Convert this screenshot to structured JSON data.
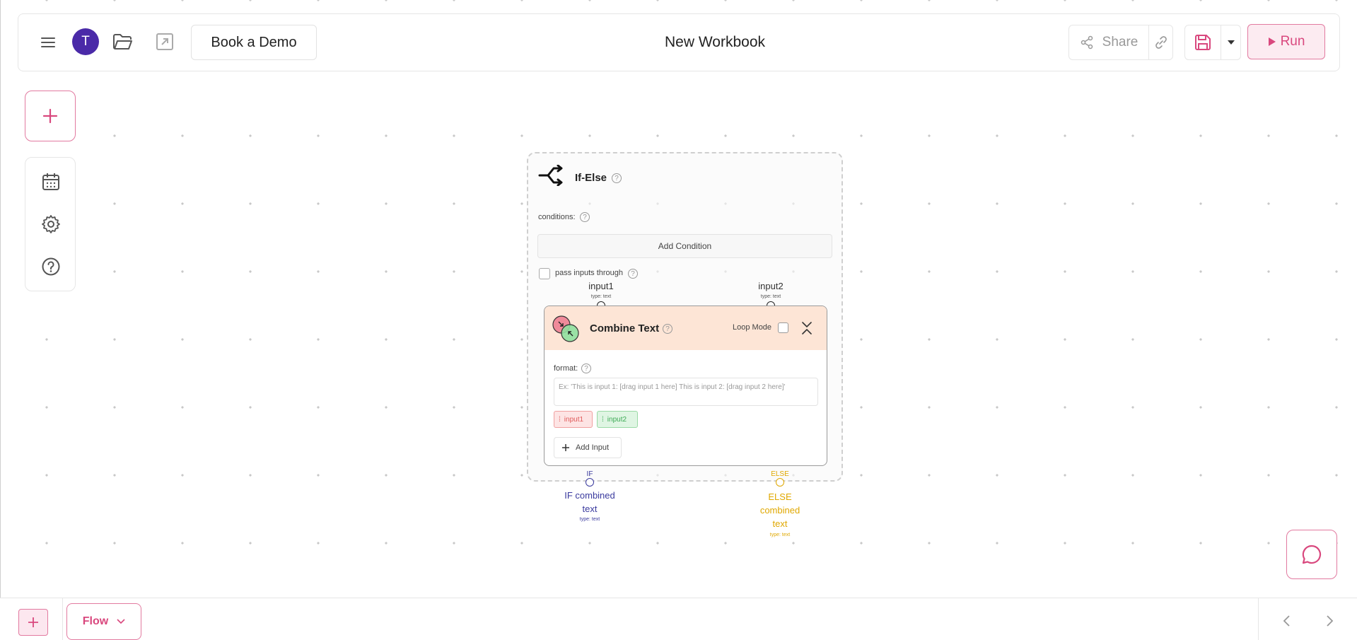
{
  "header": {
    "avatar_letter": "T",
    "book_demo_label": "Book a Demo",
    "workbook_title": "New Workbook",
    "share_label": "Share",
    "run_label": "Run"
  },
  "sidebar": {
    "icons": [
      "calendar-icon",
      "gear-icon",
      "help-icon"
    ]
  },
  "ifelse_node": {
    "title": "If-Else",
    "conditions_label": "conditions:",
    "add_condition_label": "Add Condition",
    "pass_inputs_label": "pass inputs through",
    "inputs": [
      {
        "name": "input1",
        "type": "type: text"
      },
      {
        "name": "input2",
        "type": "type: text"
      }
    ],
    "outputs": {
      "if": {
        "tag": "IF",
        "label_line1": "IF combined",
        "label_line2": "text",
        "type": "type: text"
      },
      "else": {
        "tag": "ELSE",
        "label_line1": "ELSE",
        "label_line2": "combined",
        "label_line3": "text",
        "type": "type: text"
      }
    }
  },
  "combine_node": {
    "title": "Combine Text",
    "loop_mode_label": "Loop Mode",
    "format_label": "format:",
    "format_placeholder": "Ex: 'This is input 1: [drag input 1 here] This is input 2: [drag input 2 here]'",
    "chips": [
      "input1",
      "input2"
    ],
    "add_input_label": "Add Input"
  },
  "bottom": {
    "add_label": "+",
    "flow_label": "Flow"
  },
  "colors": {
    "accent": "#d9487e",
    "avatar": "#4a2aa8",
    "if_color": "#3a3a9e",
    "else_color": "#e0a800"
  }
}
